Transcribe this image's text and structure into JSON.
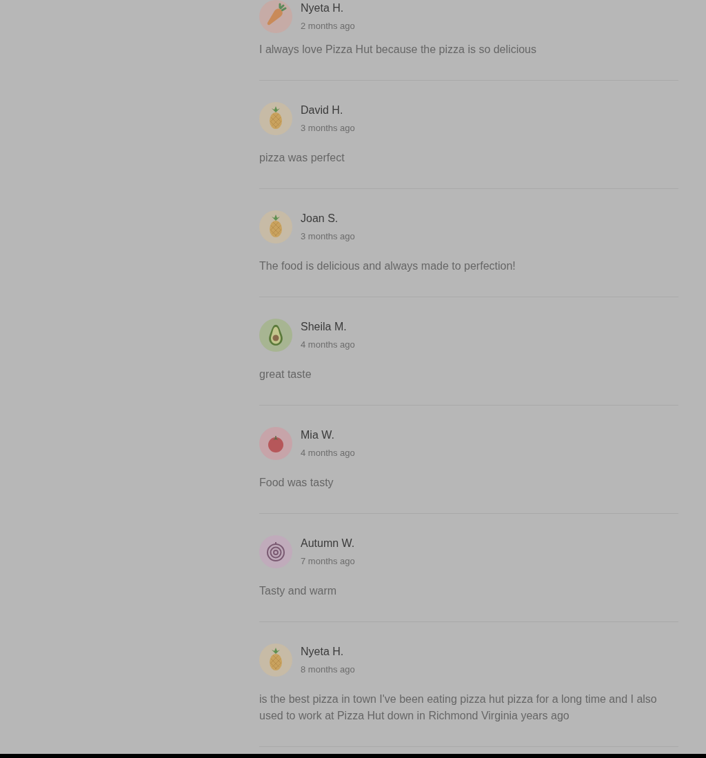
{
  "reviews": [
    {
      "avatar": {
        "kind": "carrot"
      },
      "name": "Nyeta H.",
      "time": "2 months ago",
      "text": "I always love Pizza Hut because the pizza is so delicious"
    },
    {
      "avatar": {
        "kind": "pineapple"
      },
      "name": "David H.",
      "time": "3 months ago",
      "text": "pizza was perfect"
    },
    {
      "avatar": {
        "kind": "pineapple"
      },
      "name": "Joan S.",
      "time": "3 months ago",
      "text": "The food is delicious and always made to perfection!"
    },
    {
      "avatar": {
        "kind": "avocado"
      },
      "name": "Sheila M.",
      "time": "4 months ago",
      "text": "great taste"
    },
    {
      "avatar": {
        "kind": "tomato"
      },
      "name": "Mia W.",
      "time": "4 months ago",
      "text": "Food was tasty"
    },
    {
      "avatar": {
        "kind": "onion"
      },
      "name": "Autumn W.",
      "time": "7 months ago",
      "text": "Tasty and warm"
    },
    {
      "avatar": {
        "kind": "pineapple"
      },
      "name": "Nyeta H.",
      "time": "8 months ago",
      "text": "is the best pizza in town I've been eating pizza hut pizza for a long time and I also used to work at Pizza Hut down in Richmond Virginia years ago"
    }
  ]
}
